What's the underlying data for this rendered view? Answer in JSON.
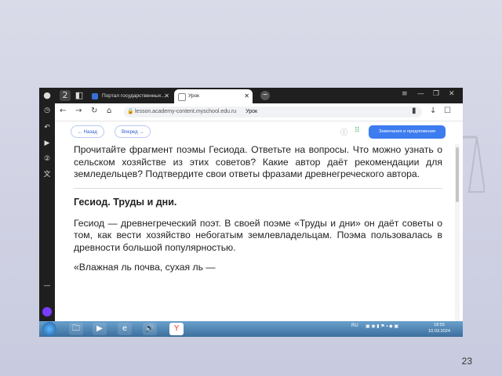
{
  "slide": {
    "page_number": "23"
  },
  "browser": {
    "tabs": [
      {
        "label": "Портал государственных..."
      },
      {
        "label": "Урок"
      }
    ],
    "url": "lesson.academy-content.myschool.edu.ru",
    "page_title": "Урок",
    "badge_count": "2"
  },
  "lesson": {
    "back_label": "Назад",
    "forward_label": "Вперед",
    "feedback_label": "Замечания и предложения"
  },
  "content": {
    "intro": "Прочитайте фрагмент поэмы Гесиода. Ответьте на вопросы. Что можно узнать о сельском хозяйстве из этих советов? Какие автор даёт рекомендации для земледельцев? Подтвердите свои ответы фразами древнегреческого автора.",
    "heading": "Гесиод. Труды и дни.",
    "body": "Гесиод — древнегреческий поэт. В своей поэме «Труды и дни» он даёт советы о том, как вести хозяйство небогатым землевладельцам. Поэма пользовалась в древности большой популярностью.",
    "quote": "«Влажная ль почва, сухая ль —"
  },
  "taskbar": {
    "lang": "RU",
    "time": "18:55",
    "date": "10.03.2024"
  },
  "colors": {
    "accent": "#3d7cf0",
    "titlebar": "#1f1f1f",
    "taskbar": "#4a7fb0"
  }
}
